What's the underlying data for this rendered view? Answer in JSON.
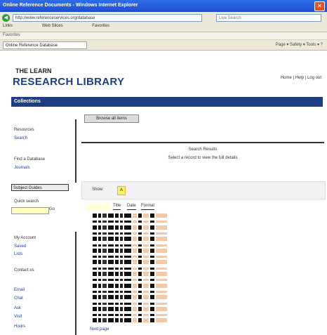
{
  "window": {
    "title": "Online Reference Documents - Windows Internet Explorer"
  },
  "browser": {
    "address": "http://www.referenceservices.org/database",
    "search_placeholder": "Live Search",
    "links": [
      "Links",
      "Web Slices",
      "Favorites"
    ],
    "favorites_label": "Favorites",
    "tab_label": "Online Reference Database",
    "tools": "Page ▾  Safety ▾  Tools ▾  ?"
  },
  "site": {
    "logo_small": "THE LEARN",
    "logo_big": "RESEARCH LIBRARY",
    "util_link": "Home | Help | Log out",
    "banner": "Collections"
  },
  "sidebar": {
    "items": [
      {
        "label": "Resources",
        "link": false
      },
      {
        "label": "Search",
        "link": true
      },
      {
        "label": "Find a Database",
        "link": false
      },
      {
        "label": "Journals",
        "link": true
      },
      {
        "label": "Subject Guides",
        "link": false
      },
      {
        "label": "Quick search",
        "link": false
      },
      {
        "label": "Go",
        "link": false
      },
      {
        "label": "My Account",
        "link": false
      },
      {
        "label": "Saved",
        "link": true
      },
      {
        "label": "Lists",
        "link": true
      },
      {
        "label": "Contact us",
        "link": false
      },
      {
        "label": "Email",
        "link": true
      },
      {
        "label": "Chat",
        "link": true
      },
      {
        "label": "Ask",
        "link": true
      },
      {
        "label": "Visit",
        "link": true
      },
      {
        "label": "Hours",
        "link": true
      }
    ]
  },
  "main": {
    "top_button": "Browse all items",
    "title": "Search Results",
    "subtitle": "Select a record to view the full details",
    "filter_label": "Show:",
    "filter_value": "A",
    "grid_header": [
      "Title",
      "Date",
      "Format"
    ],
    "footer_link": "Next page"
  }
}
